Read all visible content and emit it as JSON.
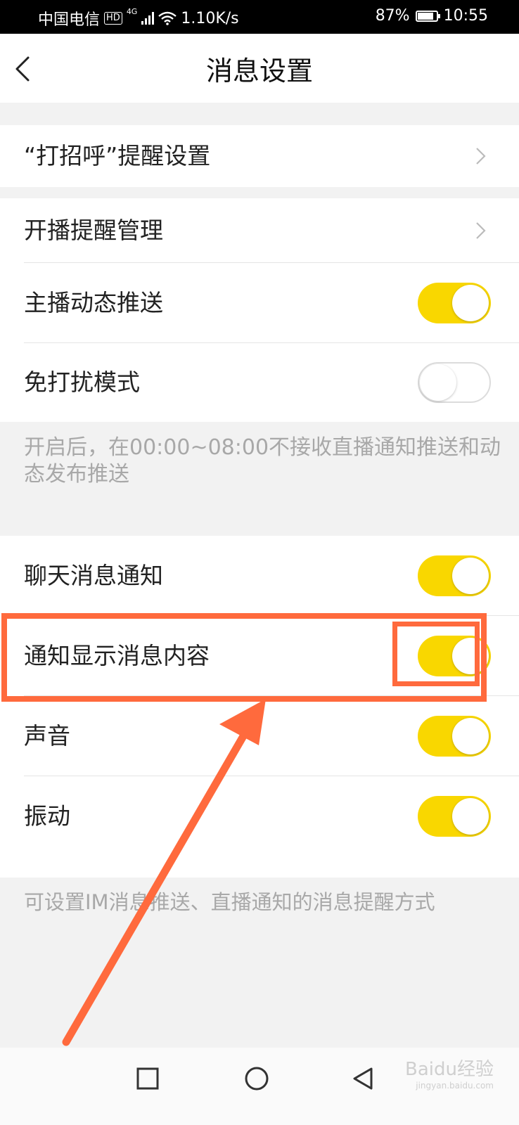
{
  "status_bar": {
    "carrier": "中国电信",
    "hd": "HD",
    "network": "4G",
    "speed": "1.10K/s",
    "battery_text": "87%",
    "battery_level": 0.87,
    "time": "10:55"
  },
  "header": {
    "back_icon": "chevron-left-icon",
    "title": "消息设置"
  },
  "sections": {
    "greeting": {
      "label": "“打招呼”提醒设置"
    },
    "live_manage": {
      "label": "开播提醒管理"
    },
    "anchor_push": {
      "label": "主播动态推送",
      "on": true
    },
    "dnd": {
      "label": "免打扰模式",
      "on": false
    },
    "dnd_hint": "开启后，在00:00~08:00不接收直播通知推送和动态发布推送",
    "chat_notify": {
      "label": "聊天消息通知",
      "on": true
    },
    "show_content": {
      "label": "通知显示消息内容",
      "on": true
    },
    "sound": {
      "label": "声音",
      "on": true
    },
    "vibrate": {
      "label": "振动",
      "on": true
    },
    "bottom_hint": "可设置IM消息推送、直播通知的消息提醒方式"
  },
  "colors": {
    "toggle_on": "#f9d700",
    "annotation": "#ff6a3d"
  },
  "system_nav": {
    "icons": [
      "square-icon",
      "circle-icon",
      "triangle-back-icon"
    ]
  },
  "watermark": {
    "text": "Baidu经验",
    "sub": "jingyan.baidu.com"
  }
}
